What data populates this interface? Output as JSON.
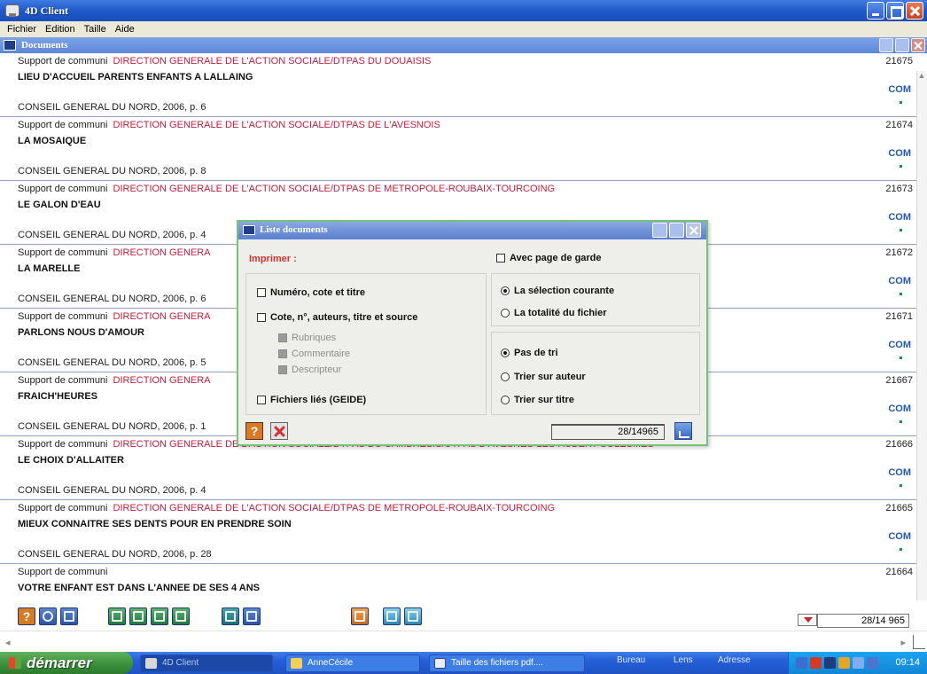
{
  "app": {
    "title": "4D Client",
    "menu": [
      "Fichier",
      "Edition",
      "Taille",
      "Aide"
    ],
    "subwindow_title": "Documents"
  },
  "records": [
    {
      "support": "Support de communi",
      "org": "DIRECTION GENERALE DE L'ACTION SOCIALE/DTPAS DU DOUAISIS",
      "title": "LIEU D'ACCUEIL PARENTS ENFANTS A LALLAING",
      "source": "CONSEIL GENERAL DU NORD, 2006, p. 6",
      "number": "21675",
      "code": "COM"
    },
    {
      "support": "Support de communi",
      "org": "DIRECTION GENERALE DE L'ACTION SOCIALE/DTPAS DE L'AVESNOIS",
      "title": "LA MOSAIQUE",
      "source": "CONSEIL GENERAL DU NORD, 2006, p. 8",
      "number": "21674",
      "code": "COM"
    },
    {
      "support": "Support de communi",
      "org": "DIRECTION GENERALE DE L'ACTION SOCIALE/DTPAS DE METROPOLE-ROUBAIX-TOURCOING",
      "title": "LE GALON D'EAU",
      "source": "CONSEIL GENERAL DU NORD, 2006, p. 4",
      "number": "21673",
      "code": "COM"
    },
    {
      "support": "Support de communi",
      "org": "DIRECTION GENERA",
      "title": "LA MARELLE",
      "source": "CONSEIL GENERAL DU NORD, 2006, p. 6",
      "number": "21672",
      "code": "COM"
    },
    {
      "support": "Support de communi",
      "org": "DIRECTION GENERA",
      "title": "PARLONS NOUS D'AMOUR",
      "source": "CONSEIL GENERAL DU NORD, 2006, p. 5",
      "number": "21671",
      "code": "COM"
    },
    {
      "support": "Support de communi",
      "org": "DIRECTION GENERA",
      "title": "FRAICH'HEURES",
      "source": "CONSEIL GENERAL DU NORD, 2006, p. 1",
      "number": "21667",
      "code": "COM"
    },
    {
      "support": "Support de communi",
      "org": "DIRECTION GENERALE DE L'ACTION SOCIALE/DTPAS DU CAMBRESIS/UTPAS D'AVESNES-LES-AUBERT SOLESMES",
      "title": "LE CHOIX D'ALLAITER",
      "source": "CONSEIL GENERAL DU NORD, 2006, p. 4",
      "number": "21666",
      "code": "COM"
    },
    {
      "support": "Support de communi",
      "org": "DIRECTION GENERALE DE L'ACTION SOCIALE/DTPAS DE METROPOLE-ROUBAIX-TOURCOING",
      "title": "MIEUX CONNAITRE SES DENTS POUR EN PRENDRE SOIN",
      "source": "CONSEIL GENERAL DU NORD, 2006, p. 28",
      "number": "21665",
      "code": "COM"
    },
    {
      "support": "Support de communi",
      "org": "",
      "title": "VOTRE ENFANT EST DANS L'ANNEE DE SES 4 ANS",
      "source": "",
      "number": "21664",
      "code": ""
    }
  ],
  "toolbar": {
    "help_label": "?",
    "record_count": "28/14 965"
  },
  "dialog": {
    "title": "Liste documents",
    "imprimer_label": "Imprimer :",
    "avec_page_de_garde": "Avec page de garde",
    "left_options": {
      "numero_cote_titre": "Numéro, cote et titre",
      "cote_auteurs": "Cote, n°, auteurs, titre et source",
      "rubriques": "Rubriques",
      "commentaire": "Commentaire",
      "descripteur": "Descripteur",
      "fichiers_lies": "Fichiers liés (GEIDE)"
    },
    "selection_options": {
      "selection_courante": "La sélection courante",
      "totalite_fichier": "La totalité du fichier"
    },
    "sort_options": {
      "pas_de_tri": "Pas de tri",
      "trier_auteur": "Trier sur auteur",
      "trier_titre": "Trier sur titre"
    },
    "count": "28/14965",
    "help_label": "?"
  },
  "taskbar": {
    "start_label": "démarrer",
    "tasks": [
      "4D Client",
      "AnneCécile",
      "Taille des fichiers pdf...."
    ],
    "quicklinks": [
      "Bureau",
      "Lens",
      "Adresse"
    ],
    "clock": "09:14"
  }
}
